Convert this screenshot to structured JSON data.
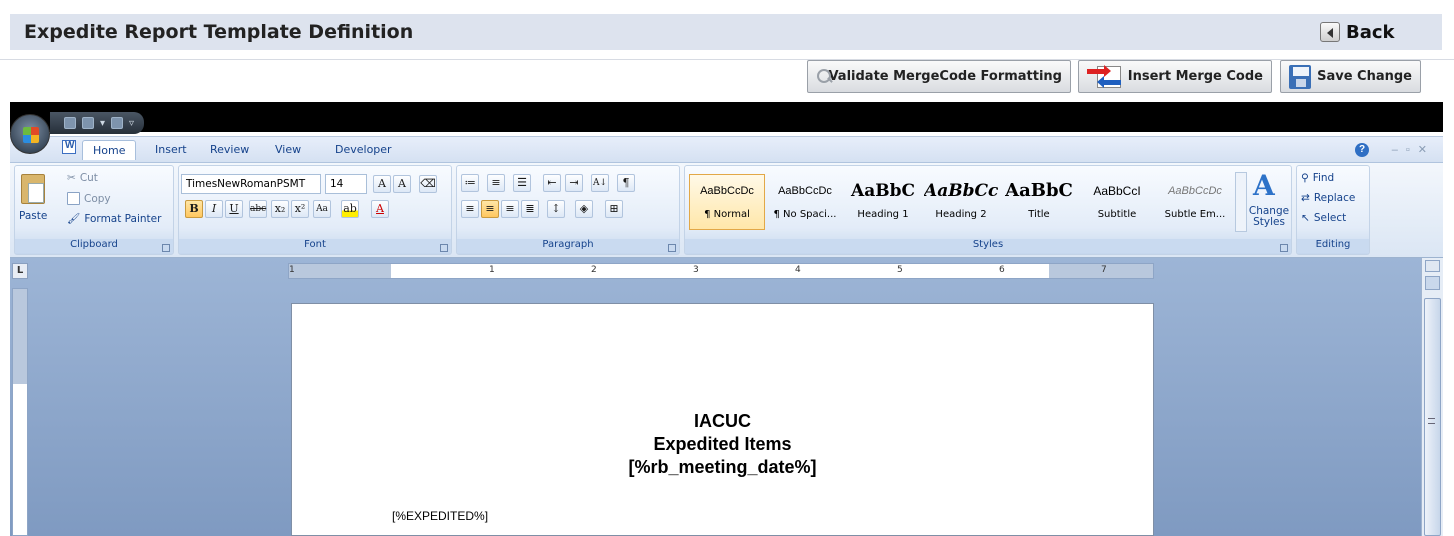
{
  "header": {
    "title": "Expedite Report Template Definition",
    "back_label": "Back"
  },
  "actions": {
    "validate_label": "Validate MergeCode Formatting",
    "insert_label": "Insert Merge Code",
    "save_label": "Save Change"
  },
  "ribbon": {
    "tabs": [
      "Home",
      "Insert",
      "Review",
      "View",
      "Developer"
    ],
    "active_tab": "Home",
    "clipboard": {
      "label": "Clipboard",
      "paste": "Paste",
      "cut": "Cut",
      "copy": "Copy",
      "format_painter": "Format Painter"
    },
    "font": {
      "label": "Font",
      "name": "TimesNewRomanPSMT",
      "size": "14"
    },
    "paragraph": {
      "label": "Paragraph"
    },
    "styles": {
      "label": "Styles",
      "items": [
        {
          "sample": "AaBbCcDc",
          "name": "¶ Normal"
        },
        {
          "sample": "AaBbCcDc",
          "name": "¶ No Spaci..."
        },
        {
          "sample": "AaBbC",
          "name": "Heading 1"
        },
        {
          "sample": "AaBbCc",
          "name": "Heading 2"
        },
        {
          "sample": "AaBbC",
          "name": "Title"
        },
        {
          "sample": "AaBbCcI",
          "name": "Subtitle"
        },
        {
          "sample": "AaBbCcDc",
          "name": "Subtle Em..."
        }
      ],
      "change_styles": "Change Styles"
    },
    "editing": {
      "label": "Editing",
      "find": "Find",
      "replace": "Replace",
      "select": "Select"
    }
  },
  "ruler_numbers": [
    "1",
    "1",
    "2",
    "3",
    "4",
    "5",
    "6",
    "7"
  ],
  "document": {
    "line1": "IACUC",
    "line2": "Expedited Items",
    "line3": "[%rb_meeting_date%]",
    "body": "[%EXPEDITED%]"
  },
  "colors": {
    "title_strip": "#dde3ee",
    "ribbon_text": "#15428b",
    "workspace": "#8ea8cc"
  }
}
